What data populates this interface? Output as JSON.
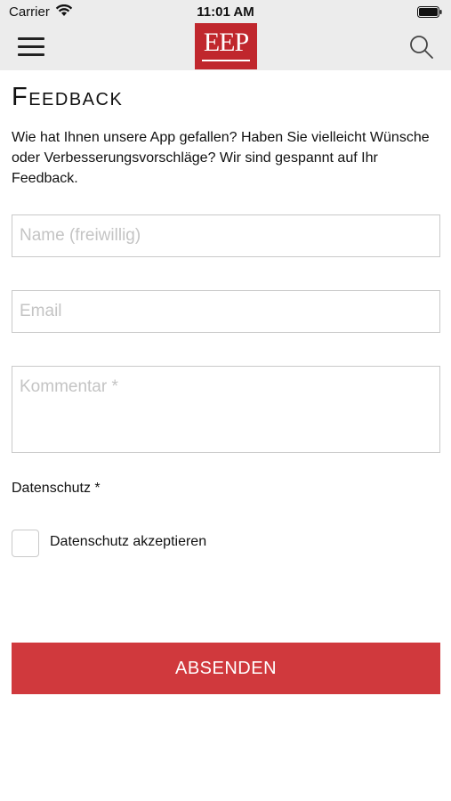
{
  "status_bar": {
    "carrier": "Carrier",
    "time": "11:01 AM"
  },
  "nav": {
    "logo_text": "EEP",
    "menu_icon": "hamburger-icon",
    "search_icon": "search-icon",
    "brand_color": "#c0272d"
  },
  "page": {
    "title": "Feedback",
    "intro": "Wie hat Ihnen unsere App gefallen? Haben Sie vielleicht Wünsche oder Verbesserungsvorschläge? Wir sind gespannt auf Ihr Feedback."
  },
  "form": {
    "name_placeholder": "Name (freiwillig)",
    "name_value": "",
    "email_placeholder": "Email",
    "email_value": "",
    "comment_placeholder": "Kommentar *",
    "comment_value": "",
    "privacy_label": "Datenschutz *",
    "privacy_checkbox_label": "Datenschutz akzeptieren",
    "privacy_checked": false,
    "submit_label": "ABSENDEN",
    "submit_color": "#d0393d"
  }
}
